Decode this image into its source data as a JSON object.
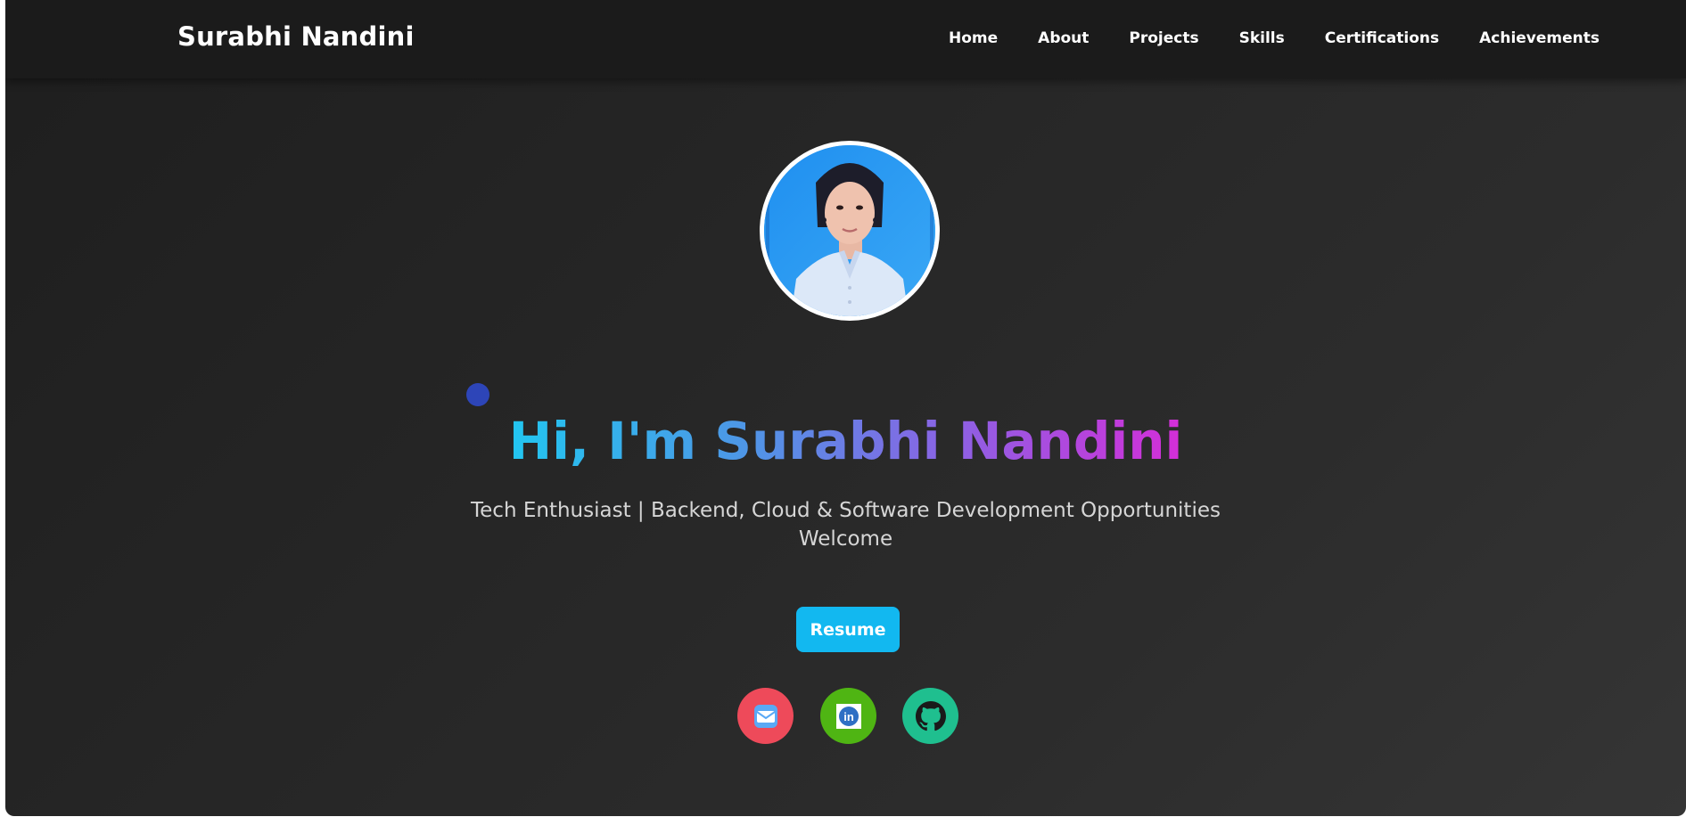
{
  "navbar": {
    "brand": "Surabhi Nandini",
    "links": [
      {
        "label": "Home"
      },
      {
        "label": "About"
      },
      {
        "label": "Projects"
      },
      {
        "label": "Skills"
      },
      {
        "label": "Certifications"
      },
      {
        "label": "Achievements"
      }
    ]
  },
  "hero": {
    "avatar_icon": "profile-photo",
    "title": "Hi, I'm Surabhi Nandini",
    "subtitle_line1": "Tech Enthusiast | Backend, Cloud & Software Development Opportunities",
    "subtitle_line2": "Welcome",
    "resume_label": "Resume"
  },
  "social": [
    {
      "icon": "mail-icon",
      "color": "#ee4a5a"
    },
    {
      "icon": "linkedin-icon",
      "color": "#4fb513"
    },
    {
      "icon": "github-icon",
      "color": "#1fbf8f"
    }
  ],
  "colors": {
    "background": "#2a2a2a",
    "navbar": "#1b1b1b",
    "accent": "#12b8f0",
    "cursor_dot": "#2d45b8"
  }
}
